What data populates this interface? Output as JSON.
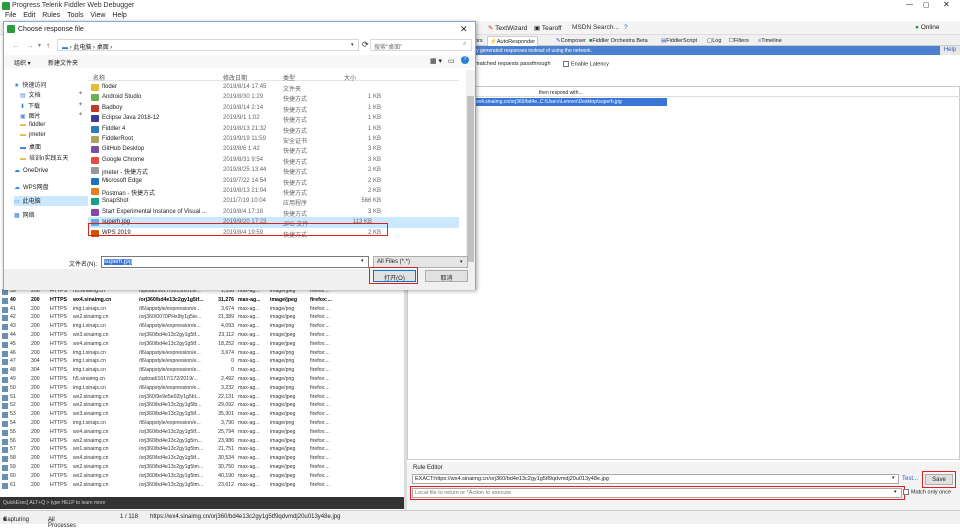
{
  "app": {
    "title": "Progress Telerik Fiddler Web Debugger",
    "menu": [
      "File",
      "Edit",
      "Rules",
      "Tools",
      "View",
      "Help"
    ],
    "online_label": "Online",
    "toolbar": {
      "textwizard": "TextWizard",
      "tearoff": "Tearoff",
      "msdn_search": "MSDN Search..."
    }
  },
  "tabs": {
    "partial_left": "ors",
    "autoresponder": "AutoResponder",
    "composer": "Composer",
    "orchestra": "Fiddler Orchestra Beta",
    "fiddlerscript": "FiddlerScript",
    "log": "Log",
    "filters": "Filters",
    "timeline": "Timeline"
  },
  "autoresponder": {
    "banner": "ly generated responses instead of using the network.",
    "help": "Help",
    "passthrough_label": "matched requests passthrough",
    "latency_label": "Enable Latency",
    "grid_header_then": "then respond with...",
    "rule_match": "wx4.sinaimg.cn/orj360/bd4e...",
    "rule_response": "C:\\Users\\Lenovo\\Desktop\\superh.jpg"
  },
  "rule_editor": {
    "label": "Rule Editor",
    "match_value": "EXACT:https://wx4.sinaimg.cn/orj360/bd4e13c2gy1g5tf9qdvmdj20u013y48e.jpg",
    "test_label": "Test...",
    "save_label": "Save",
    "response_placeholder": "Local file to return or *Action to execute",
    "match_only_once": "Match only once"
  },
  "dialog": {
    "title": "Choose response file",
    "breadcrumb": [
      "此电脑",
      "桌面"
    ],
    "search_placeholder": "搜索\"桌面\"",
    "organize": "组织 ▾",
    "new_folder": "新建文件夹",
    "columns": {
      "name": "名称",
      "modified": "修改日期",
      "type": "类型",
      "size": "大小"
    },
    "nav": [
      {
        "label": "快速访问",
        "icon": "star-icon",
        "indent": 0
      },
      {
        "label": "文档",
        "icon": "document-folder-icon",
        "indent": 1
      },
      {
        "label": "下载",
        "icon": "download-icon",
        "indent": 1
      },
      {
        "label": "图片",
        "icon": "pictures-icon",
        "indent": 1
      },
      {
        "label": "fiddler",
        "icon": "folder-icon",
        "indent": 1
      },
      {
        "label": "jmeter",
        "icon": "folder-icon",
        "indent": 1
      },
      {
        "label": "桌面",
        "icon": "desktop-icon",
        "indent": 1
      },
      {
        "label": "培训n实践五天",
        "icon": "folder-icon",
        "indent": 1
      },
      {
        "label": "OneDrive",
        "icon": "cloud-icon",
        "indent": 0
      },
      {
        "label": "WPS网盘",
        "icon": "cloud-drive-icon",
        "indent": 0
      },
      {
        "label": "此电脑",
        "icon": "computer-icon",
        "indent": 0
      },
      {
        "label": "网络",
        "icon": "network-icon",
        "indent": 0
      }
    ],
    "files": [
      {
        "name": "floder",
        "date": "2019/8/14 17:45",
        "type": "文件夹",
        "size": "",
        "color": "#e8b93a"
      },
      {
        "name": "Android Studio",
        "date": "2019/8/30 1:29",
        "type": "快捷方式",
        "size": "1 KB",
        "color": "#6ab04c"
      },
      {
        "name": "Badboy",
        "date": "2019/8/14 2:14",
        "type": "快捷方式",
        "size": "1 KB",
        "color": "#c0392b"
      },
      {
        "name": "Eclipse Java 2018-12",
        "date": "2019/9/1 1:02",
        "type": "快捷方式",
        "size": "1 KB",
        "color": "#3b3b8f"
      },
      {
        "name": "Fiddler 4",
        "date": "2019/8/13 21:32",
        "type": "快捷方式",
        "size": "1 KB",
        "color": "#2c7fb8"
      },
      {
        "name": "FiddlerRoot",
        "date": "2019/9/19 11:59",
        "type": "安全证书",
        "size": "1 KB",
        "color": "#b0a060"
      },
      {
        "name": "GitHub Desktop",
        "date": "2019/8/6 1:42",
        "type": "快捷方式",
        "size": "3 KB",
        "color": "#7b4fa0"
      },
      {
        "name": "Google Chrome",
        "date": "2019/8/31 9:54",
        "type": "快捷方式",
        "size": "3 KB",
        "color": "#e74c3c"
      },
      {
        "name": "jmeter - 快捷方式",
        "date": "2019/8/25 13:44",
        "type": "快捷方式",
        "size": "2 KB",
        "color": "#999999"
      },
      {
        "name": "Microsoft Edge",
        "date": "2019/7/22 14:54",
        "type": "快捷方式",
        "size": "2 KB",
        "color": "#1e73be"
      },
      {
        "name": "Postman - 快捷方式",
        "date": "2019/8/13 21:04",
        "type": "快捷方式",
        "size": "2 KB",
        "color": "#e67e22"
      },
      {
        "name": "SnapShot",
        "date": "2011/7/19 10:04",
        "type": "应用程序",
        "size": "566 KB",
        "color": "#16a085"
      },
      {
        "name": "Start Experimental Instance of Visual ...",
        "date": "2019/8/4 17:18",
        "type": "快捷方式",
        "size": "3 KB",
        "color": "#8e44ad"
      },
      {
        "name": "superh.jpg",
        "date": "2019/9/20 17:23",
        "type": "JPG 文件",
        "size": "113 KB",
        "color": "#5dade2"
      },
      {
        "name": "WPS 2019",
        "date": "2019/8/4 19:59",
        "type": "快捷方式",
        "size": "2 KB",
        "color": "#d35400"
      }
    ],
    "selected_index": 13,
    "filename_label": "文件名(N):",
    "filename_value": "superh.jpg",
    "filter_value": "All Files (*.*)",
    "open_label": "打开(O)",
    "cancel_label": "取消"
  },
  "sessions": [
    {
      "id": "39",
      "result": "200",
      "protocol": "HTTPS",
      "host": "h5.sinaimg.cn",
      "url": "/upload/1017/1015/2019/...",
      "body": "1,358",
      "caching": "max-ag...",
      "ctype": "image/jpeg",
      "process": "firefox:..."
    },
    {
      "id": "40",
      "result": "200",
      "protocol": "HTTPS",
      "host": "wx4.sinaimg.cn",
      "url": "/orj360/bd4e13c2gy1g5tf...",
      "body": "31,276",
      "caching": "max-ag...",
      "ctype": "image/jpeg",
      "process": "firefox:..."
    },
    {
      "id": "41",
      "result": "200",
      "protocol": "HTTPS",
      "host": "img.t.sinajs.cn",
      "url": "/t6/appstyle/expression/e...",
      "body": "3,674",
      "caching": "max-ag...",
      "ctype": "image/png",
      "process": "firefox:..."
    },
    {
      "id": "42",
      "result": "200",
      "protocol": "HTTPS",
      "host": "wx2.sinaimg.cn",
      "url": "/orj360/0070PHs9ly1g5ie...",
      "body": "21,389",
      "caching": "max-ag...",
      "ctype": "image/jpeg",
      "process": "firefox:..."
    },
    {
      "id": "43",
      "result": "200",
      "protocol": "HTTPS",
      "host": "img.t.sinajs.cn",
      "url": "/t6/appstyle/expression/e...",
      "body": "4,093",
      "caching": "max-ag...",
      "ctype": "image/png",
      "process": "firefox:..."
    },
    {
      "id": "44",
      "result": "200",
      "protocol": "HTTPS",
      "host": "wx3.sinaimg.cn",
      "url": "/orj360/bd4e13c2gy1g5tf...",
      "body": "23,112",
      "caching": "max-ag...",
      "ctype": "image/jpeg",
      "process": "firefox:..."
    },
    {
      "id": "45",
      "result": "200",
      "protocol": "HTTPS",
      "host": "wx4.sinaimg.cn",
      "url": "/orj360/bd4e13c2gy1g5tf...",
      "body": "18,252",
      "caching": "max-ag...",
      "ctype": "image/jpeg",
      "process": "firefox:..."
    },
    {
      "id": "46",
      "result": "200",
      "protocol": "HTTPS",
      "host": "img.t.sinajs.cn",
      "url": "/t6/appstyle/expression/e...",
      "body": "3,674",
      "caching": "max-ag...",
      "ctype": "image/png",
      "process": "firefox:..."
    },
    {
      "id": "47",
      "result": "304",
      "protocol": "HTTPS",
      "host": "img.t.sinajs.cn",
      "url": "/t6/appstyle/expression/e...",
      "body": "0",
      "caching": "max-ag...",
      "ctype": "image/png",
      "process": "firefox:..."
    },
    {
      "id": "48",
      "result": "304",
      "protocol": "HTTPS",
      "host": "img.t.sinajs.cn",
      "url": "/t6/appstyle/expression/e...",
      "body": "0",
      "caching": "max-ag...",
      "ctype": "image/png",
      "process": "firefox:..."
    },
    {
      "id": "49",
      "result": "200",
      "protocol": "HTTPS",
      "host": "h5.sinaimg.cn",
      "url": "/upload/1017/172/2019/...",
      "body": "2,492",
      "caching": "max-ag...",
      "ctype": "image/png",
      "process": "firefox:..."
    },
    {
      "id": "50",
      "result": "200",
      "protocol": "HTTPS",
      "host": "img.t.sinajs.cn",
      "url": "/t6/appstyle/expression/e...",
      "body": "3,232",
      "caching": "max-ag...",
      "ctype": "image/png",
      "process": "firefox:..."
    },
    {
      "id": "51",
      "result": "200",
      "protocol": "HTTPS",
      "host": "wx2.sinaimg.cn",
      "url": "/orj360/9e9e5e02ly1g5bl...",
      "body": "22,131",
      "caching": "max-ag...",
      "ctype": "image/jpeg",
      "process": "firefox:..."
    },
    {
      "id": "52",
      "result": "200",
      "protocol": "HTTPS",
      "host": "wx2.sinaimg.cn",
      "url": "/orj360/bd4e13c2gy1g5lb...",
      "body": "29,092",
      "caching": "max-ag...",
      "ctype": "image/jpeg",
      "process": "firefox:..."
    },
    {
      "id": "53",
      "result": "200",
      "protocol": "HTTPS",
      "host": "wx3.sinaimg.cn",
      "url": "/orj360/bd4e13c2gy1g5tf...",
      "body": "35,301",
      "caching": "max-ag...",
      "ctype": "image/jpeg",
      "process": "firefox:..."
    },
    {
      "id": "54",
      "result": "200",
      "protocol": "HTTPS",
      "host": "img.t.sinajs.cn",
      "url": "/t6/appstyle/expression/e...",
      "body": "3,790",
      "caching": "max-ag...",
      "ctype": "image/png",
      "process": "firefox:..."
    },
    {
      "id": "55",
      "result": "200",
      "protocol": "HTTPS",
      "host": "wx4.sinaimg.cn",
      "url": "/orj360/bd4e13c2gy1g5tf...",
      "body": "25,794",
      "caching": "max-ag...",
      "ctype": "image/jpeg",
      "process": "firefox:..."
    },
    {
      "id": "56",
      "result": "200",
      "protocol": "HTTPS",
      "host": "wx2.sinaimg.cn",
      "url": "/orj360/bd4e13c2gy1g5rn...",
      "body": "23,986",
      "caching": "max-ag...",
      "ctype": "image/jpeg",
      "process": "firefox:..."
    },
    {
      "id": "57",
      "result": "200",
      "protocol": "HTTPS",
      "host": "wx1.sinaimg.cn",
      "url": "/orj360/bd4e13c2gy1g5tm...",
      "body": "21,751",
      "caching": "max-ag...",
      "ctype": "image/jpeg",
      "process": "firefox:..."
    },
    {
      "id": "58",
      "result": "200",
      "protocol": "HTTPS",
      "host": "wx4.sinaimg.cn",
      "url": "/orj360/bd4e13c2gy1g5tf...",
      "body": "30,534",
      "caching": "max-ag...",
      "ctype": "image/jpeg",
      "process": "firefox:..."
    },
    {
      "id": "59",
      "result": "200",
      "protocol": "HTTPS",
      "host": "wx2.sinaimg.cn",
      "url": "/orj360/bd4e13c2gy1g5tm...",
      "body": "30,750",
      "caching": "max-ag...",
      "ctype": "image/jpeg",
      "process": "firefox:..."
    },
    {
      "id": "60",
      "result": "200",
      "protocol": "HTTPS",
      "host": "wx2.sinaimg.cn",
      "url": "/orj360/bd4e13c2gy1g5tm...",
      "body": "40,190",
      "caching": "max-ag...",
      "ctype": "image/jpeg",
      "process": "firefox:..."
    },
    {
      "id": "61",
      "result": "200",
      "protocol": "HTTPS",
      "host": "wx2.sinaimg.cn",
      "url": "/orj360/bd4e13c2gy1g5tm...",
      "body": "23,612",
      "caching": "max-ag...",
      "ctype": "image/jpeg",
      "process": "firefox:..."
    }
  ],
  "quickexec": "QuickExec] ALT+Q > type HELP to learn more",
  "status": {
    "capturing": "Capturing",
    "processes": "All Processes",
    "count": "1 / 118",
    "url": "https://wx4.sinaimg.cn/orj360/bd4e13c2gy1g5tf9qdvmdj20u013y48e.jpg"
  },
  "colors": {
    "accent": "#3875d7",
    "banner": "#4b7fd0",
    "highlight": "#e02020"
  }
}
